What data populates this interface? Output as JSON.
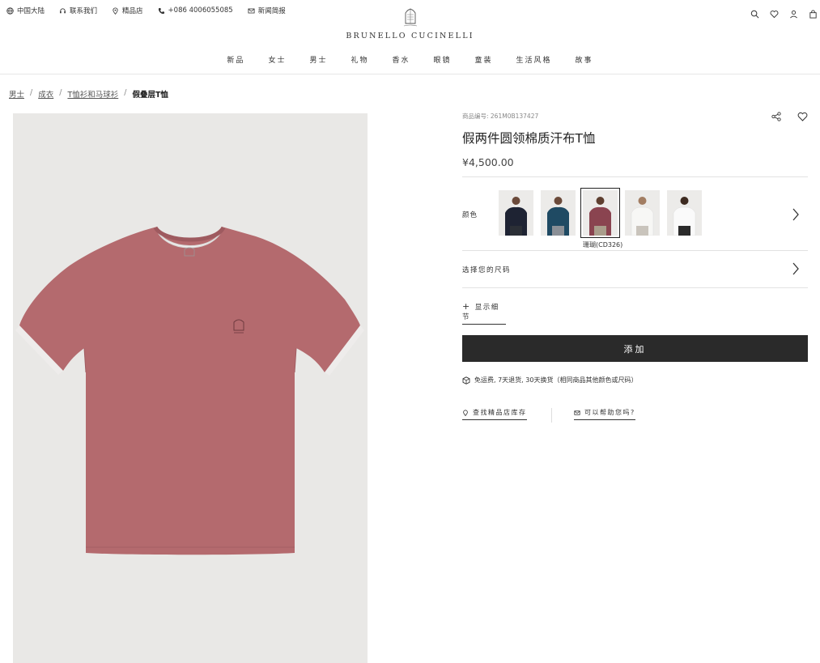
{
  "utility_bar": {
    "region": "中国大陆",
    "contact": "联系我们",
    "stores": "精品店",
    "phone": "+086 4006055085",
    "newsletter": "新闻简报"
  },
  "header": {
    "brand": "BRUNELLO CUCINELLI",
    "icons": [
      "search-icon",
      "heart-icon",
      "user-icon",
      "bag-icon"
    ]
  },
  "nav": {
    "items": [
      "新品",
      "女士",
      "男士",
      "礼物",
      "香水",
      "眼镜",
      "童装",
      "生活风格",
      "故事"
    ]
  },
  "breadcrumb": {
    "items": [
      "男士",
      "成衣",
      "T恤衫和马球衫"
    ],
    "current": "假叠层T恤"
  },
  "product": {
    "sku": "商品编号: 261M0B137427",
    "title": "假两件圆领棉质汗布T恤",
    "price": "¥4,500.00",
    "color_label": "颜色",
    "selected_color": "珊瑚(CD326)",
    "swatches": [
      {
        "name": "navy",
        "shirt": "#1e2333"
      },
      {
        "name": "teal",
        "shirt": "#1f4a63"
      },
      {
        "name": "coral",
        "shirt": "#8a4450"
      },
      {
        "name": "white",
        "shirt": "#e7e7e5"
      },
      {
        "name": "white-2",
        "shirt": "#f2f2f2"
      }
    ],
    "size_label": "选择您的尺码",
    "details_label": "显示细节",
    "add_button": "添加",
    "shipping_note": "免运费, 7天退货, 30天换货（相同商品其他颜色或尺码）",
    "find_store": "查找精品店库存",
    "help": "可以帮助您吗?"
  },
  "colors": {
    "shirt": "#b46a6e",
    "photo_bg": "#e9e8e6",
    "button": "#2a2a2a"
  }
}
